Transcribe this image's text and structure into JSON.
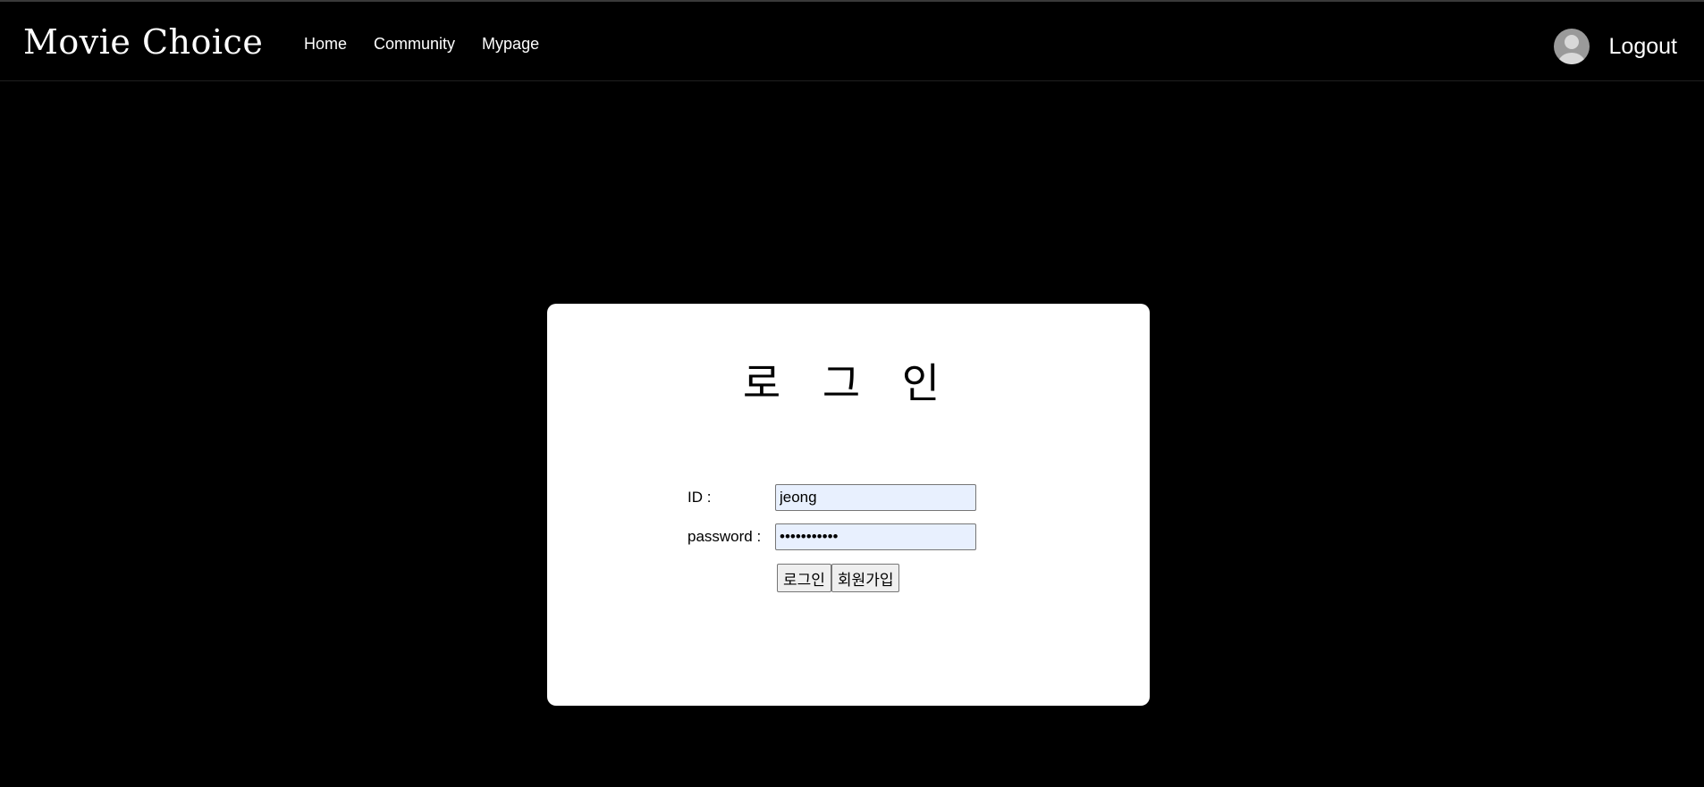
{
  "header": {
    "brand": "Movie Choice",
    "nav": [
      "Home",
      "Community",
      "Mypage"
    ],
    "avatar_icon": "user-avatar-icon",
    "logout_label": "Logout"
  },
  "login": {
    "title": "로 그 인",
    "id_label": "ID :",
    "id_value": "jeong",
    "password_label": "password :",
    "password_value": "•••••••••••",
    "login_button": "로그인",
    "signup_button": "회원가입"
  },
  "colors": {
    "background": "#000000",
    "card": "#ffffff",
    "input_fill": "#e8f0fe"
  }
}
